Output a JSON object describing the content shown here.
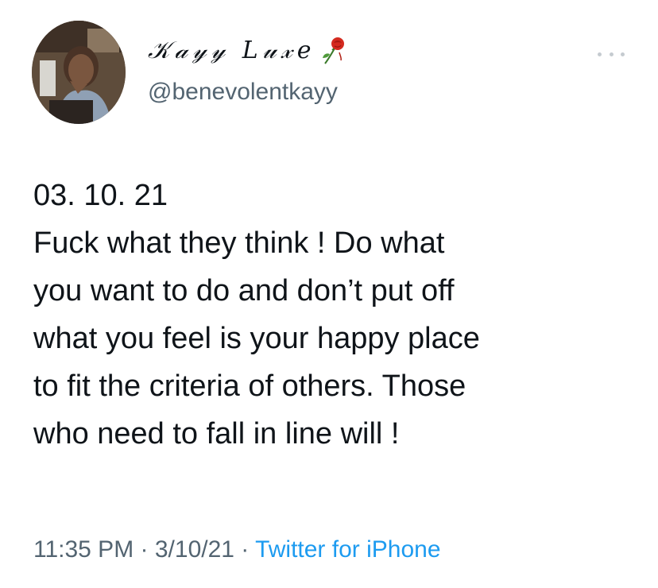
{
  "author": {
    "display_name": "𝒦𝒶𝓎𝓎 𝐿𝓊𝓍𝑒",
    "name_icon": "rose-icon",
    "username": "@benevolentkayy"
  },
  "more_menu": {
    "icon": "more-horizontal-icon"
  },
  "tweet": {
    "text_lines": [
      "03. 10. 21",
      "Fuck what they think ! Do what",
      "you want to do and don’t put off",
      "what you feel is your happy place",
      "to fit the criteria of others. Those",
      "who need to fall in line will !"
    ]
  },
  "meta": {
    "time": "11:35 PM",
    "separator": " · ",
    "date": "3/10/21",
    "source": "Twitter for iPhone"
  },
  "colors": {
    "text": "#0f1419",
    "secondary": "#536471",
    "link": "#1d9bf0",
    "more_dots": "#c5cbd0"
  }
}
